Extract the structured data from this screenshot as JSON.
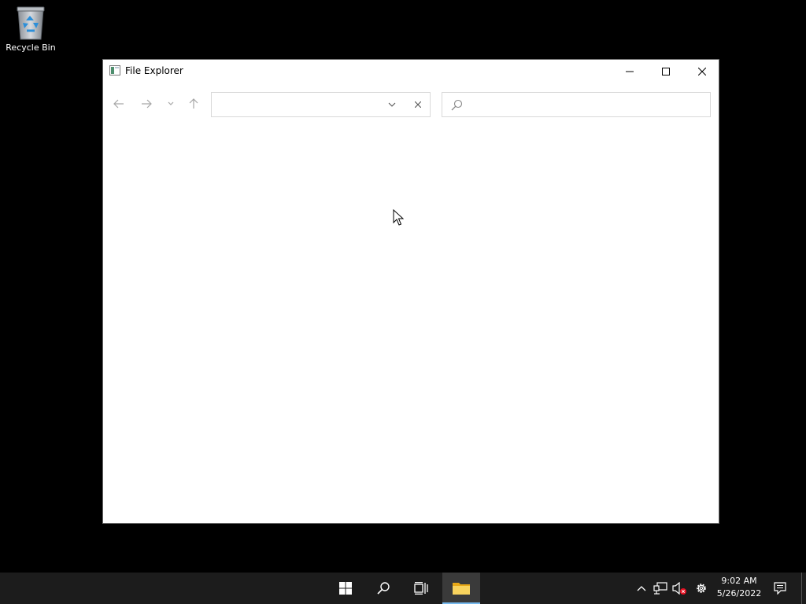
{
  "desktop": {
    "icons": [
      {
        "label": "Recycle Bin",
        "icon": "recycle-bin-icon"
      }
    ]
  },
  "window": {
    "title": "File Explorer",
    "app_icon": "file-explorer-app-icon",
    "controls": {
      "minimize": "minimize-icon",
      "maximize": "maximize-icon",
      "close": "close-icon"
    },
    "nav": {
      "back": "arrow-left-icon",
      "forward": "arrow-right-icon",
      "recent": "chevron-down-icon",
      "up": "arrow-up-icon"
    },
    "address": {
      "value": "",
      "placeholder": ""
    },
    "search": {
      "value": "",
      "placeholder": ""
    }
  },
  "taskbar": {
    "buttons": [
      "start-icon",
      "search-icon",
      "task-view-icon",
      "file-explorer-icon"
    ],
    "tray": [
      "chevron-up-icon",
      "network-icon",
      "volume-muted-icon",
      "settings-icon"
    ],
    "clock": {
      "time": "9:02 AM",
      "date": "5/26/2022"
    },
    "notifications": "action-center-icon",
    "accent_color": "#76b9ed"
  }
}
